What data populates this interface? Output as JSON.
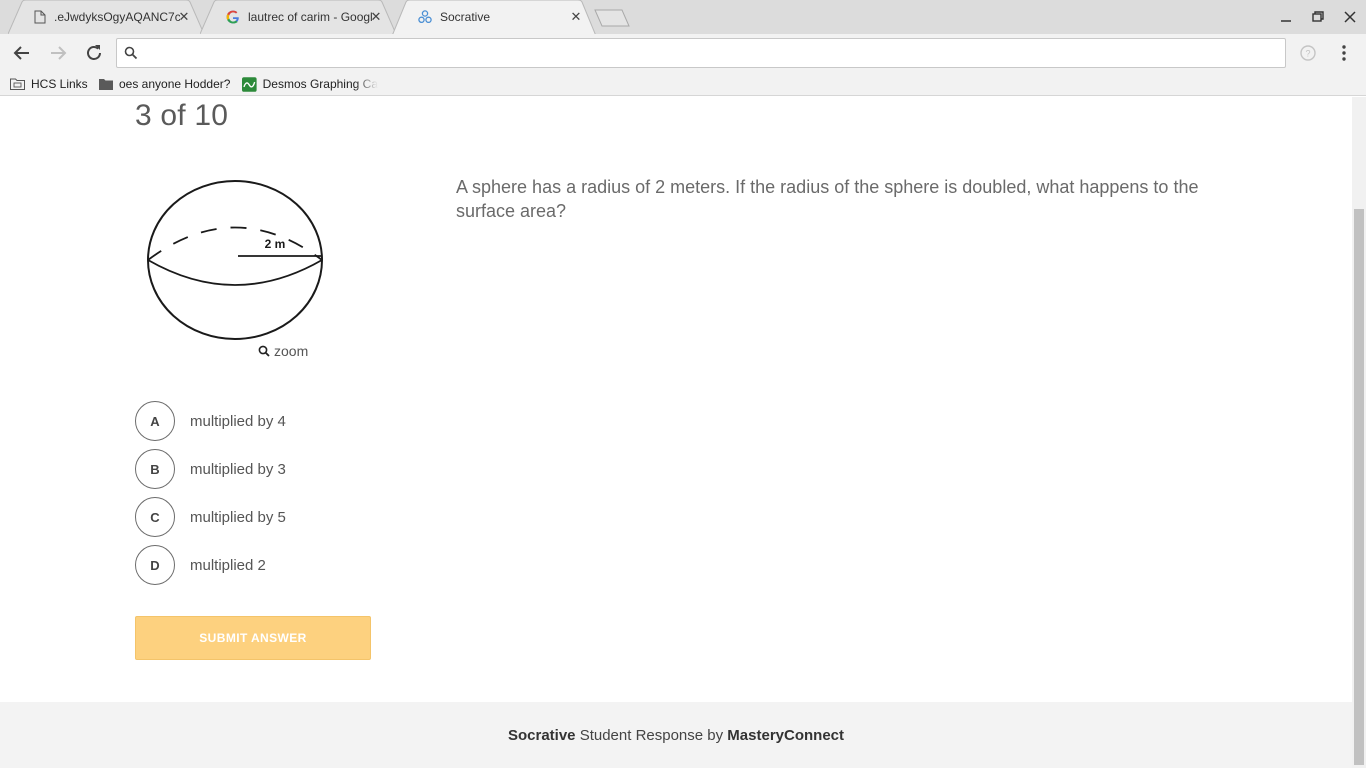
{
  "browser": {
    "tabs": [
      {
        "title": ".eJwdyksOgyAQANC7c",
        "icon": "document-icon",
        "active": false
      },
      {
        "title": "lautrec of carim - Google",
        "icon": "google-icon",
        "active": false
      },
      {
        "title": "Socrative",
        "icon": "socrative-icon",
        "active": true
      }
    ],
    "address": {
      "value": "",
      "placeholder": ""
    },
    "bookmarks": [
      {
        "label": "HCS Links",
        "icon": "bookmarks-folder-icon"
      },
      {
        "label": "oes anyone Hodder?",
        "icon": "folder-icon"
      },
      {
        "label": "Desmos Graphing Ca",
        "icon": "desmos-icon"
      }
    ]
  },
  "quiz": {
    "progress": "3 of 10",
    "image_label": "2 m",
    "zoom_label": "zoom",
    "question": "A sphere has a radius of 2 meters. If the radius of the sphere is doubled, what happens to the surface area?",
    "choices": [
      {
        "letter": "A",
        "text": "multiplied by 4"
      },
      {
        "letter": "B",
        "text": "multiplied by 3"
      },
      {
        "letter": "C",
        "text": "multiplied by 5"
      },
      {
        "letter": "D",
        "text": "multiplied 2"
      }
    ],
    "submit_label": "SUBMIT ANSWER"
  },
  "footer": {
    "brand": "Socrative",
    "middle": " Student Response by ",
    "company": "MasteryConnect"
  },
  "colors": {
    "submit_bg": "#fdd17f",
    "tabstrip_bg": "#dcdcdc",
    "footer_bg": "#f3f3f3"
  }
}
